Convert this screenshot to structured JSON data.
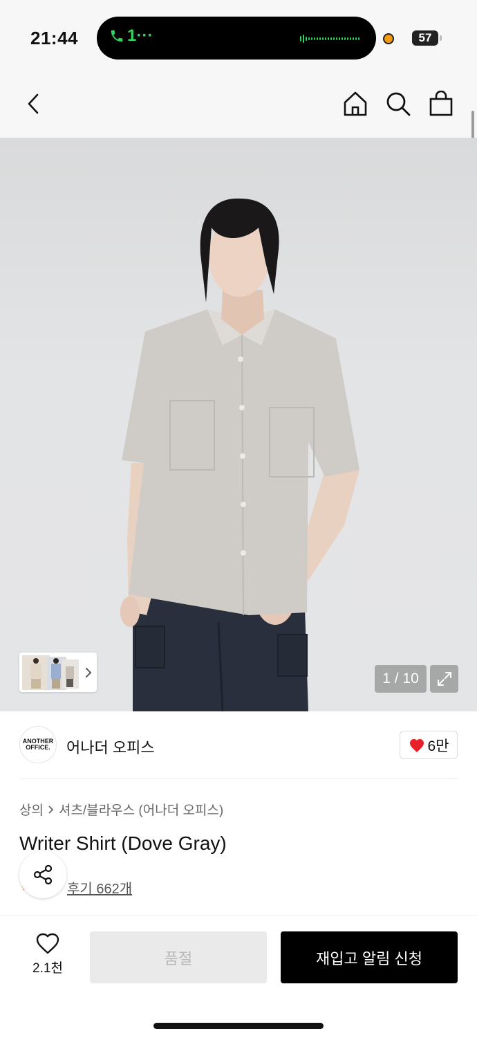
{
  "status_bar": {
    "time": "21:44",
    "call_label": "1···",
    "battery": "57",
    "icons": [
      "phone-icon",
      "audio-wave-icon",
      "recording-dot-icon",
      "battery-icon"
    ]
  },
  "nav": {
    "icons": [
      "back-arrow-icon",
      "home-icon",
      "search-icon",
      "cart-bag-icon"
    ]
  },
  "gallery": {
    "counter": "1 / 10",
    "icons": [
      "thumbnail-chevron-icon",
      "expand-icon"
    ]
  },
  "brand": {
    "logo_line1": "ANOTHER",
    "logo_line2": "OFFICE.",
    "name": "어나더 오피스",
    "likes": "6만"
  },
  "product": {
    "breadcrumb": [
      "상의",
      "셔츠/블라우스 (어나더 오피스)"
    ],
    "title": "Writer Shirt (Dove Gray)",
    "reviews": "후기 662개"
  },
  "bottom_bar": {
    "wish_count": "2.1천",
    "soldout_label": "품절",
    "restock_label": "재입고 알림 신청"
  },
  "colors": {
    "accent_black": "#000000",
    "heart_red": "#e8202a",
    "call_green": "#33d35a"
  }
}
